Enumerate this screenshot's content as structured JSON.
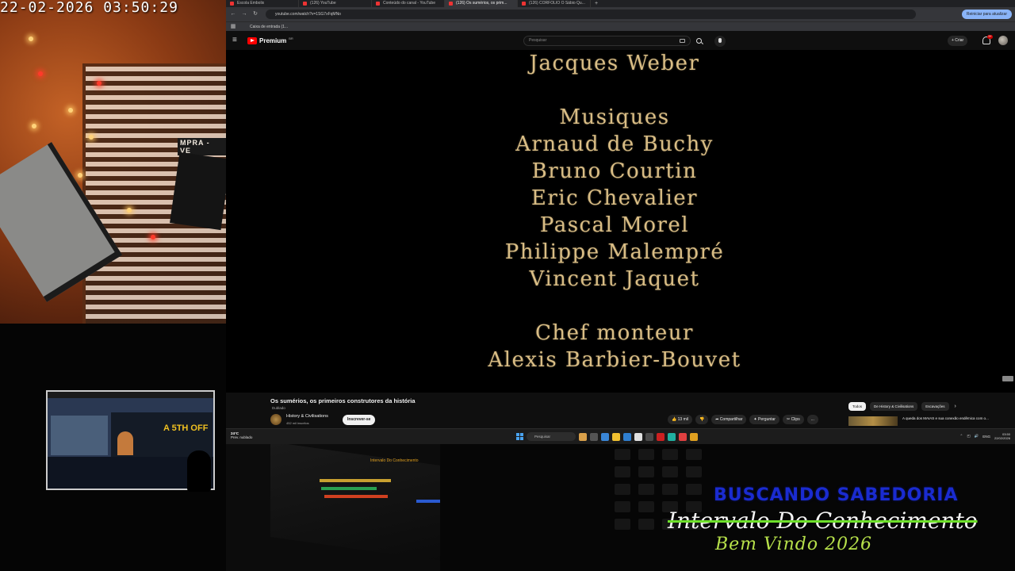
{
  "camera": {
    "timestamp": "22-02-2026  03:50:29",
    "sign_text": "MPRA - VE"
  },
  "browser": {
    "tabs": [
      {
        "label": "Escola Embolix"
      },
      {
        "label": "(126) YouTube"
      },
      {
        "label": "Conteúdo do canal - YouTube"
      },
      {
        "label": "(126) Os sumérios, os prim..."
      },
      {
        "label": "(126) CORFOLIO O Sábio Qu..."
      }
    ],
    "url": "youtube.com/watch?v=1SG7xFqMNo",
    "update_label": "Reiniciar para atualizar",
    "bookmark": "Caixa de entrada (1..."
  },
  "youtube": {
    "logo": "Premium",
    "logo_sup": "BR",
    "search_placeholder": "Pesquisar",
    "create_label": "+ Criar",
    "notif_count": "9+"
  },
  "credits": [
    "Jacques Weber",
    "Musiques",
    "Arnaud de Buchy",
    "Bruno Courtin",
    "Eric Chevalier",
    "Pascal Morel",
    "Philippe Malempré",
    "Vincent Jaquet",
    "Chef monteur",
    "Alexis Barbier-Bouvet"
  ],
  "video": {
    "title": "Os sumérios, os primeiros construtores da história",
    "dubbed": "Dublado",
    "channel": "History & Civilisations",
    "subscribers": "452 mil inscritos",
    "subscribe": "Inscrever-se",
    "likes": "13 mil",
    "share": "Compartilhar",
    "ask": "Perguntar",
    "clips": "Clips",
    "more": "...",
    "chips": [
      "Todos",
      "De History & Civilisations",
      "Escavações"
    ],
    "rec_title": "A queda dos MAIAS e sua conexão endêmica com o..."
  },
  "taskbar": {
    "temp": "24°C",
    "weather": "Prev. nublado",
    "search": "Pesquisar",
    "lang": "ENG",
    "time": "03:50",
    "date": "22/02/2026"
  },
  "studio": {
    "label": "Intervalo Do Conhecimento"
  },
  "overlay": {
    "line1": "BUSCANDO SABEDORIA",
    "line2": "Intervalo Do Conhecimento",
    "line3": "Bem Vindo 2026"
  },
  "thumb": {
    "label": "A 5TH OFF"
  },
  "colors": {
    "credits": "#d9bd85",
    "overlay_blue": "#1a2bd0",
    "overlay_green": "#b6e04a",
    "strike_green": "#6de02a",
    "yt_red": "#ff0000"
  }
}
